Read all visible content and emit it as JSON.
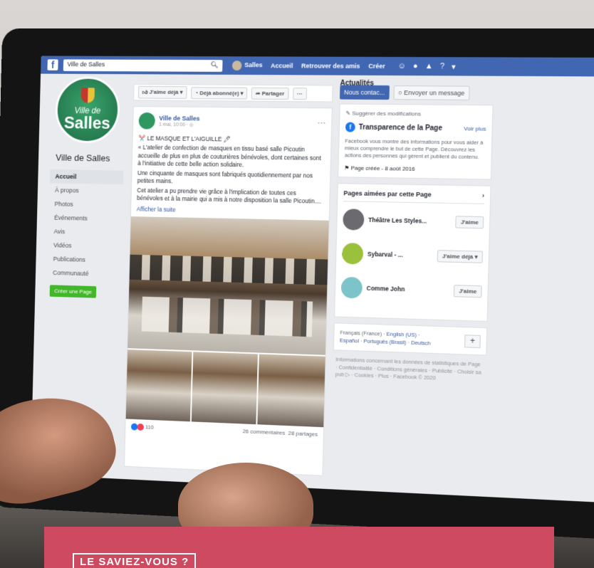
{
  "topbar": {
    "logo": "f",
    "search_text": "Ville de Salles",
    "search_icon": "search-icon",
    "user": "Salles",
    "links": [
      "Accueil",
      "Retrouver des amis",
      "Créer"
    ],
    "icons": [
      "friends-icon",
      "messenger-icon",
      "bell-icon",
      "help-icon",
      "chevron-down-icon"
    ]
  },
  "profile": {
    "pic_line1": "Ville de",
    "pic_line2": "Salles",
    "name": "Ville de Salles"
  },
  "sidebar": {
    "items": [
      {
        "label": "Accueil"
      },
      {
        "label": "À propos"
      },
      {
        "label": "Photos"
      },
      {
        "label": "Événements"
      },
      {
        "label": "Avis"
      },
      {
        "label": "Vidéos"
      },
      {
        "label": "Publications"
      },
      {
        "label": "Communauté"
      }
    ],
    "create_page": "Créer une Page"
  },
  "actions": {
    "like": "J'aime déjà ▾",
    "subscribed": "Déjà abonné(e) ▾",
    "share": "Partager",
    "more": "···",
    "section_title": "Actualités"
  },
  "post": {
    "author": "Ville de Salles",
    "time": "1 mai, 10:00 · ",
    "more": "···",
    "title": "✂️ LE MASQUE ET L'AIGUILLE 🖊",
    "paragraphs": [
      "« L'atelier de confection de masques en tissu basé salle Picoutin accueille de plus en plus de couturières bénévoles, dont certaines sont à l'initiative de cette belle action solidaire.",
      "Une cinquante de masques sont fabriqués quotidiennement par nos petites mains.",
      "Cet atelier a pu prendre vie grâce à l'implication de toutes ces bénévoles et à la mairie qui a mis à notre disposition la salle Picoutin...."
    ],
    "see_more": "Afficher la suite",
    "reactions": "110",
    "comments": "26 commentaires",
    "shares": "28 partages"
  },
  "right": {
    "contact": "Nous contac...",
    "message": "Envoyer un message",
    "suggest": "Suggérer des modifications",
    "transparency": {
      "title": "Transparence de la Page",
      "see_all": "Voir plus",
      "desc": "Facebook vous montre des informations pour vous aider à mieux comprendre le but de cette Page. Découvrez les actions des personnes qui gèrent et publient du contenu.",
      "created": "Page créée - 8 août 2016"
    },
    "liked": {
      "title": "Pages aimées par cette Page",
      "items": [
        {
          "name": "Théâtre Les Styles...",
          "button": "J'aime",
          "color": "#6b6a6e"
        },
        {
          "name": "Sybarval - ...",
          "button": "J'aime déjà ▾",
          "color": "#9bc13c"
        },
        {
          "name": "Comme John",
          "button": "J'aime",
          "color": "#7cc4c9"
        }
      ]
    },
    "languages": {
      "line1": "Français (France) · ",
      "english": "English (US)",
      "espanol": "Español",
      "portugues": "Português (Brasil)",
      "deutsch": "Deutsch",
      "plus": "+"
    },
    "footer": "Informations concernant les données de statistiques de Page · Confidentialité · Conditions générales · Publicité · Choisir sa pub ▷ · Cookies · Plus · Facebook © 2020"
  },
  "banner": {
    "label": "LE SAVIEZ-VOUS ?"
  }
}
